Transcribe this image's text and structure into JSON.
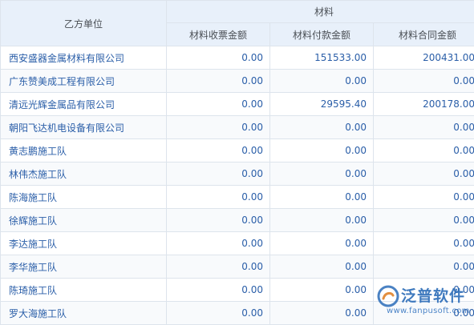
{
  "table": {
    "party_b_header": "乙方单位",
    "material_header": "材料",
    "sub_headers": [
      "材料收票金额",
      "材料付款金额",
      "材料合同金额"
    ],
    "rows": [
      {
        "name": "西安盛器金属材料有限公司",
        "receipt": "0.00",
        "payment": "151533.00",
        "contract": "200431.00"
      },
      {
        "name": "广东赞美成工程有限公司",
        "receipt": "0.00",
        "payment": "0.00",
        "contract": "0.00"
      },
      {
        "name": "清远光辉金属品有限公司",
        "receipt": "0.00",
        "payment": "29595.40",
        "contract": "200178.00"
      },
      {
        "name": "朝阳飞达机电设备有限公司",
        "receipt": "0.00",
        "payment": "0.00",
        "contract": "0.00"
      },
      {
        "name": "黄志鹏施工队",
        "receipt": "0.00",
        "payment": "0.00",
        "contract": "0.00"
      },
      {
        "name": "林伟杰施工队",
        "receipt": "0.00",
        "payment": "0.00",
        "contract": "0.00"
      },
      {
        "name": "陈海施工队",
        "receipt": "0.00",
        "payment": "0.00",
        "contract": "0.00"
      },
      {
        "name": "徐辉施工队",
        "receipt": "0.00",
        "payment": "0.00",
        "contract": "0.00"
      },
      {
        "name": "李达施工队",
        "receipt": "0.00",
        "payment": "0.00",
        "contract": "0.00"
      },
      {
        "name": "李华施工队",
        "receipt": "0.00",
        "payment": "0.00",
        "contract": "0.00"
      },
      {
        "name": "陈琦施工队",
        "receipt": "0.00",
        "payment": "0.00",
        "contract": "0.00"
      },
      {
        "name": "罗大海施工队",
        "receipt": "0.00",
        "payment": "0.00",
        "contract": "0.00"
      }
    ]
  },
  "watermark": {
    "brand": "泛普软件",
    "url": "www.fanpusoft.com",
    "icon": "fanpu-logo-icon"
  },
  "colors": {
    "header_bg": "#e8f0fa",
    "link_text": "#2a5ea8",
    "border": "#dde4ec"
  }
}
